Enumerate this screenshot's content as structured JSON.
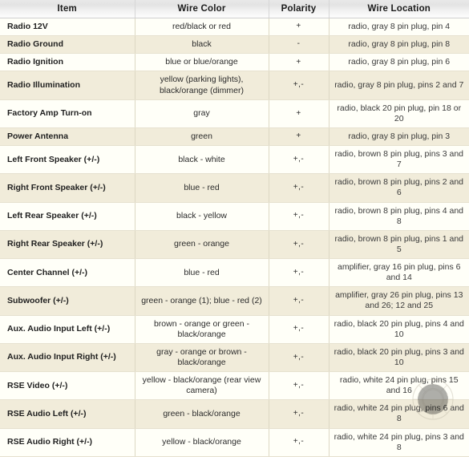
{
  "table": {
    "columns": [
      {
        "key": "item",
        "label": "Item"
      },
      {
        "key": "color",
        "label": "Wire Color"
      },
      {
        "key": "polarity",
        "label": "Polarity"
      },
      {
        "key": "location",
        "label": "Wire Location"
      }
    ],
    "rows": [
      {
        "item": "Radio 12V",
        "color": "red/black or red",
        "polarity": "+",
        "location": "radio, gray 8 pin plug, pin 4"
      },
      {
        "item": "Radio Ground",
        "color": "black",
        "polarity": "-",
        "location": "radio, gray 8 pin plug, pin 8"
      },
      {
        "item": "Radio Ignition",
        "color": "blue or blue/orange",
        "polarity": "+",
        "location": "radio, gray 8 pin plug, pin 6"
      },
      {
        "item": "Radio Illumination",
        "color": "yellow (parking lights), black/orange (dimmer)",
        "polarity": "+,-",
        "location": "radio, gray 8 pin plug, pins 2 and 7"
      },
      {
        "item": "Factory Amp Turn-on",
        "color": "gray",
        "polarity": "+",
        "location": "radio, black 20 pin plug, pin 18 or 20"
      },
      {
        "item": "Power Antenna",
        "color": "green",
        "polarity": "+",
        "location": "radio, gray 8 pin plug, pin 3"
      },
      {
        "item": "Left Front Speaker (+/-)",
        "color": "black - white",
        "polarity": "+,-",
        "location": "radio, brown 8 pin plug, pins 3 and 7"
      },
      {
        "item": "Right Front Speaker (+/-)",
        "color": "blue - red",
        "polarity": "+,-",
        "location": "radio, brown 8 pin plug, pins 2 and 6"
      },
      {
        "item": "Left Rear Speaker (+/-)",
        "color": "black - yellow",
        "polarity": "+,-",
        "location": "radio, brown 8 pin plug, pins 4 and 8"
      },
      {
        "item": "Right Rear Speaker (+/-)",
        "color": "green - orange",
        "polarity": "+,-",
        "location": "radio, brown 8 pin plug, pins 1 and 5"
      },
      {
        "item": "Center Channel (+/-)",
        "color": "blue - red",
        "polarity": "+,-",
        "location": "amplifier, gray 16 pin plug, pins 6 and 14"
      },
      {
        "item": "Subwoofer (+/-)",
        "color": "green - orange (1); blue - red (2)",
        "polarity": "+,-",
        "location": "amplifier, gray 26 pin plug, pins 13 and 26; 12 and 25"
      },
      {
        "item": "Aux. Audio Input Left (+/-)",
        "color": "brown - orange or green - black/orange",
        "polarity": "+,-",
        "location": "radio, black 20 pin plug, pins 4 and 10"
      },
      {
        "item": "Aux. Audio Input Right (+/-)",
        "color": "gray - orange or brown - black/orange",
        "polarity": "+,-",
        "location": "radio, black 20 pin plug, pins 3 and 10"
      },
      {
        "item": "RSE Video (+/-)",
        "color": "yellow - black/orange (rear view camera)",
        "polarity": "+,-",
        "location": "radio, white 24 pin plug, pins 15 and 16"
      },
      {
        "item": "RSE Audio Left (+/-)",
        "color": "green - black/orange",
        "polarity": "+,-",
        "location": "radio, white 24 pin plug, pins 6 and 8"
      },
      {
        "item": "RSE Audio Right (+/-)",
        "color": "yellow - black/orange",
        "polarity": "+,-",
        "location": "radio, white 24 pin plug, pins 3 and 8"
      }
    ]
  },
  "watermark": {
    "name": "circular-logo-watermark"
  },
  "colors": {
    "header_top": "#e3e3e3",
    "header_bottom": "#fdfdfd",
    "row_odd": "#fffff8",
    "row_even": "#f1ecda",
    "border": "#ddd8c4",
    "text": "#2b2b2b"
  }
}
